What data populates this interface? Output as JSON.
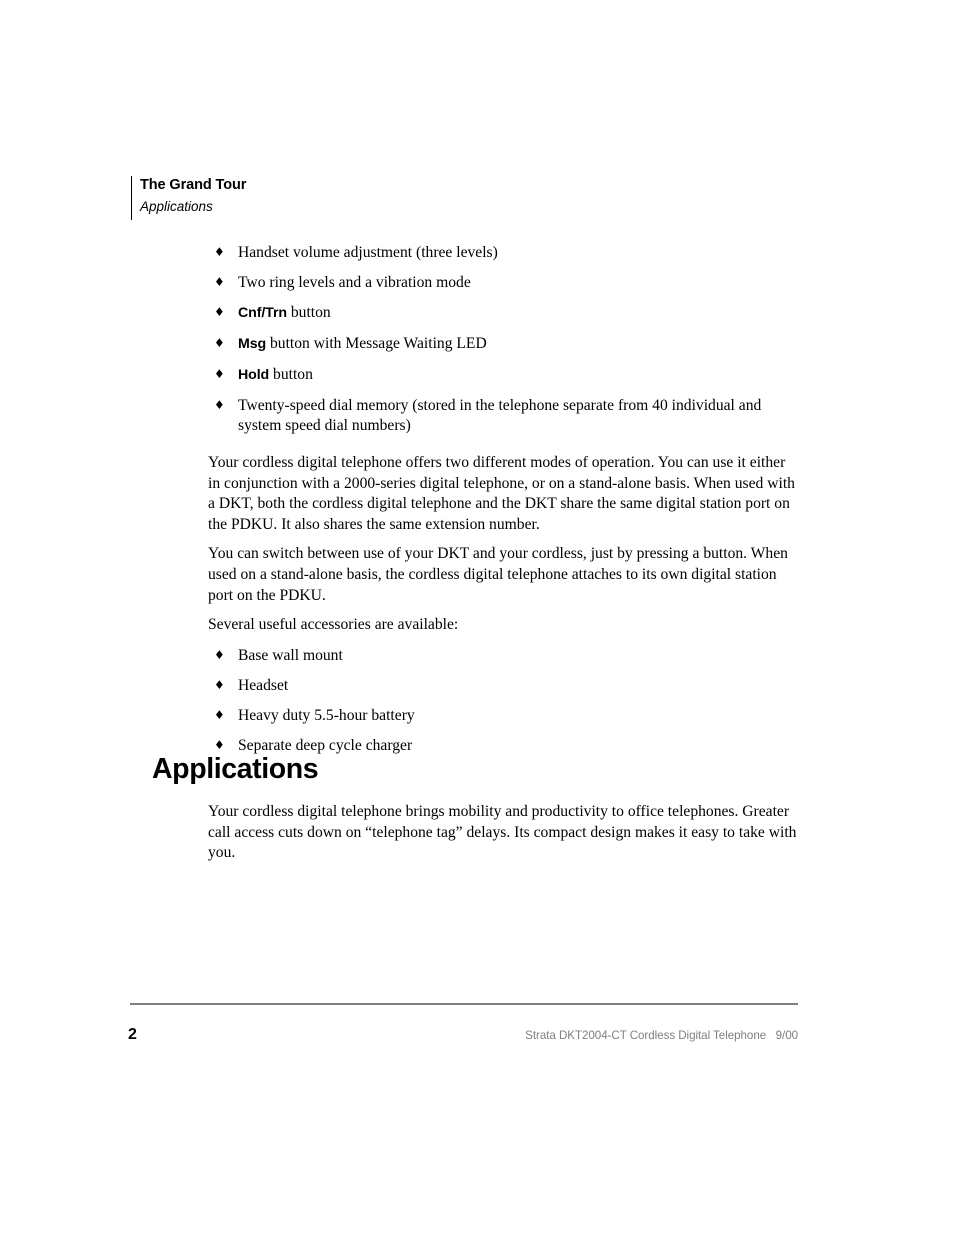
{
  "document": {
    "header": {
      "chapter_title": "The Grand Tour",
      "section_name": "Applications"
    },
    "feature_list": [
      {
        "bullet": "♦",
        "text": "Handset volume adjustment (three levels)"
      },
      {
        "bullet": "♦",
        "text": "Two ring levels and a vibration mode"
      },
      {
        "bullet": "♦",
        "keyword": "Cnf/Trn",
        "text": " button"
      },
      {
        "bullet": "♦",
        "keyword": "Msg",
        "text": " button with Message Waiting LED"
      },
      {
        "bullet": "♦",
        "keyword": "Hold",
        "text": " button"
      },
      {
        "bullet": "♦",
        "text": "Twenty-speed dial memory (stored in the telephone separate from 40 individual and system speed dial numbers)"
      }
    ],
    "paragraphs": [
      "Your cordless digital telephone offers two different modes of operation. You can use it either in conjunction with a 2000-series digital telephone, or on a stand-alone basis. When used with a DKT, both the cordless digital telephone and the DKT share the same digital station port on the PDKU. It also shares the same extension number.",
      "You can switch between use of your DKT and your cordless, just by pressing a button. When used on a stand-alone basis, the cordless digital telephone attaches to its own digital station port on the PDKU.",
      "Several useful accessories are available:"
    ],
    "accessory_list": [
      {
        "bullet": "♦",
        "text": "Base wall mount"
      },
      {
        "bullet": "♦",
        "text": "Headset"
      },
      {
        "bullet": "♦",
        "text": "Heavy duty 5.5-hour battery"
      },
      {
        "bullet": "♦",
        "text": "Separate deep cycle charger"
      }
    ],
    "section": {
      "heading": "Applications",
      "body": "Your cordless digital telephone brings mobility and productivity to office telephones. Greater call access cuts down on “telephone tag” delays. Its compact design makes it easy to take with you."
    },
    "footer": {
      "page_number": "2",
      "text": "Strata DKT2004-CT Cordless Digital Telephone   9/00"
    },
    "colors": {
      "text": "#000000",
      "footer_text": "#7f7f7f",
      "footer_rule": "#808080",
      "page_background": "#ffffff"
    }
  }
}
